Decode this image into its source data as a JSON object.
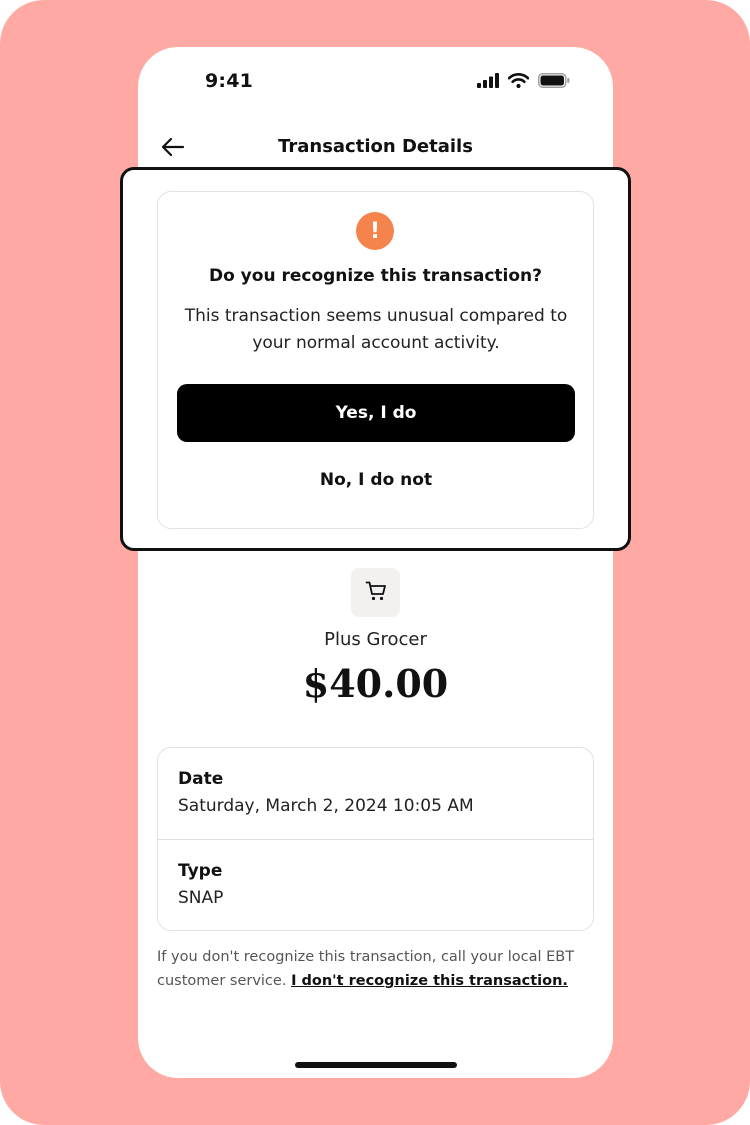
{
  "status_bar": {
    "time": "9:41",
    "icons": [
      "signal-icon",
      "wifi-icon",
      "battery-icon"
    ]
  },
  "header": {
    "title": "Transaction Details",
    "back_icon": "arrow-left-icon"
  },
  "alert_modal": {
    "icon": "exclamation-icon",
    "icon_glyph": "!",
    "heading": "Do you recognize this transaction?",
    "body": "This transaction seems unusual compared to your normal account activity.",
    "yes_label": "Yes, I do",
    "no_label": "No, I do not"
  },
  "transaction": {
    "merchant_icon": "shopping-cart-icon",
    "merchant": "Plus Grocer",
    "amount": "$40.00"
  },
  "details": [
    {
      "label": "Date",
      "value": "Saturday, March 2, 2024 10:05 AM"
    },
    {
      "label": "Type",
      "value": "SNAP"
    }
  ],
  "footer": {
    "note": "If you don't recognize this transaction, call your local EBT customer service.",
    "link_label": "I don't recognize this transaction."
  },
  "colors": {
    "background": "#ffa9a4",
    "alert_accent": "#f5844c",
    "primary_button": "#000000"
  }
}
